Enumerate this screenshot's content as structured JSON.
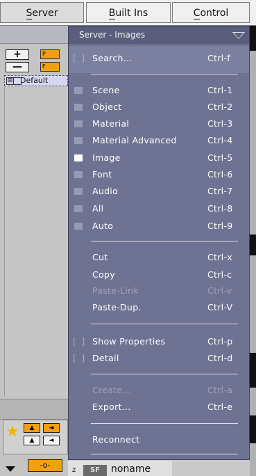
{
  "tabs": [
    {
      "label_pre": "",
      "label_ul": "S",
      "label_post": "erver"
    },
    {
      "label_pre": "",
      "label_ul": "B",
      "label_post": "uilt Ins"
    },
    {
      "label_pre": "",
      "label_ul": "C",
      "label_post": "ontrol"
    }
  ],
  "left_panel": {
    "plus_button": "+",
    "minus_button": "—",
    "orange_1": "P",
    "orange_2": "F",
    "tree_item": "Default",
    "tree_expand": "⊞",
    "bottom_name": "noname",
    "bottom_z": "z",
    "bottom_thumb": "SF"
  },
  "menu": {
    "title": "Server - Images",
    "items": [
      {
        "bracket": "[ ]",
        "label": "Search...",
        "shortcut": "Ctrl-f"
      },
      {
        "label": "Scene",
        "shortcut": "Ctrl-1",
        "checked": false
      },
      {
        "label": "Object",
        "shortcut": "Ctrl-2",
        "checked": false
      },
      {
        "label": "Material",
        "shortcut": "Ctrl-3",
        "checked": false
      },
      {
        "label": "Material Advanced",
        "shortcut": "Ctrl-4",
        "checked": false
      },
      {
        "label": "Image",
        "shortcut": "Ctrl-5",
        "checked": true
      },
      {
        "label": "Font",
        "shortcut": "Ctrl-6",
        "checked": false
      },
      {
        "label": "Audio",
        "shortcut": "Ctrl-7",
        "checked": false
      },
      {
        "label": "All",
        "shortcut": "Ctrl-8",
        "checked": false
      },
      {
        "label": "Auto",
        "shortcut": "Ctrl-9",
        "checked": false
      },
      {
        "label": "Cut",
        "shortcut": "Ctrl-x"
      },
      {
        "label": "Copy",
        "shortcut": "Ctrl-c"
      },
      {
        "label": "Paste-Link",
        "shortcut": "Ctrl-v",
        "disabled": true
      },
      {
        "label": "Paste-Dup.",
        "shortcut": "Ctrl-V"
      },
      {
        "bracket": "[ ]",
        "label": "Show Properties",
        "shortcut": "Ctrl-p"
      },
      {
        "bracket": "[ ]",
        "label": "Detail",
        "shortcut": "Ctrl-d"
      },
      {
        "label": "Create...",
        "shortcut": "Ctrl-a",
        "disabled": true
      },
      {
        "label": "Export...",
        "shortcut": "Ctrl-e"
      },
      {
        "label": "Reconnect",
        "shortcut": ""
      }
    ]
  },
  "colors": {
    "menu_bg": "#6f7393",
    "menu_header": "#5a5e7c",
    "accent_orange": "#f2a00f"
  }
}
